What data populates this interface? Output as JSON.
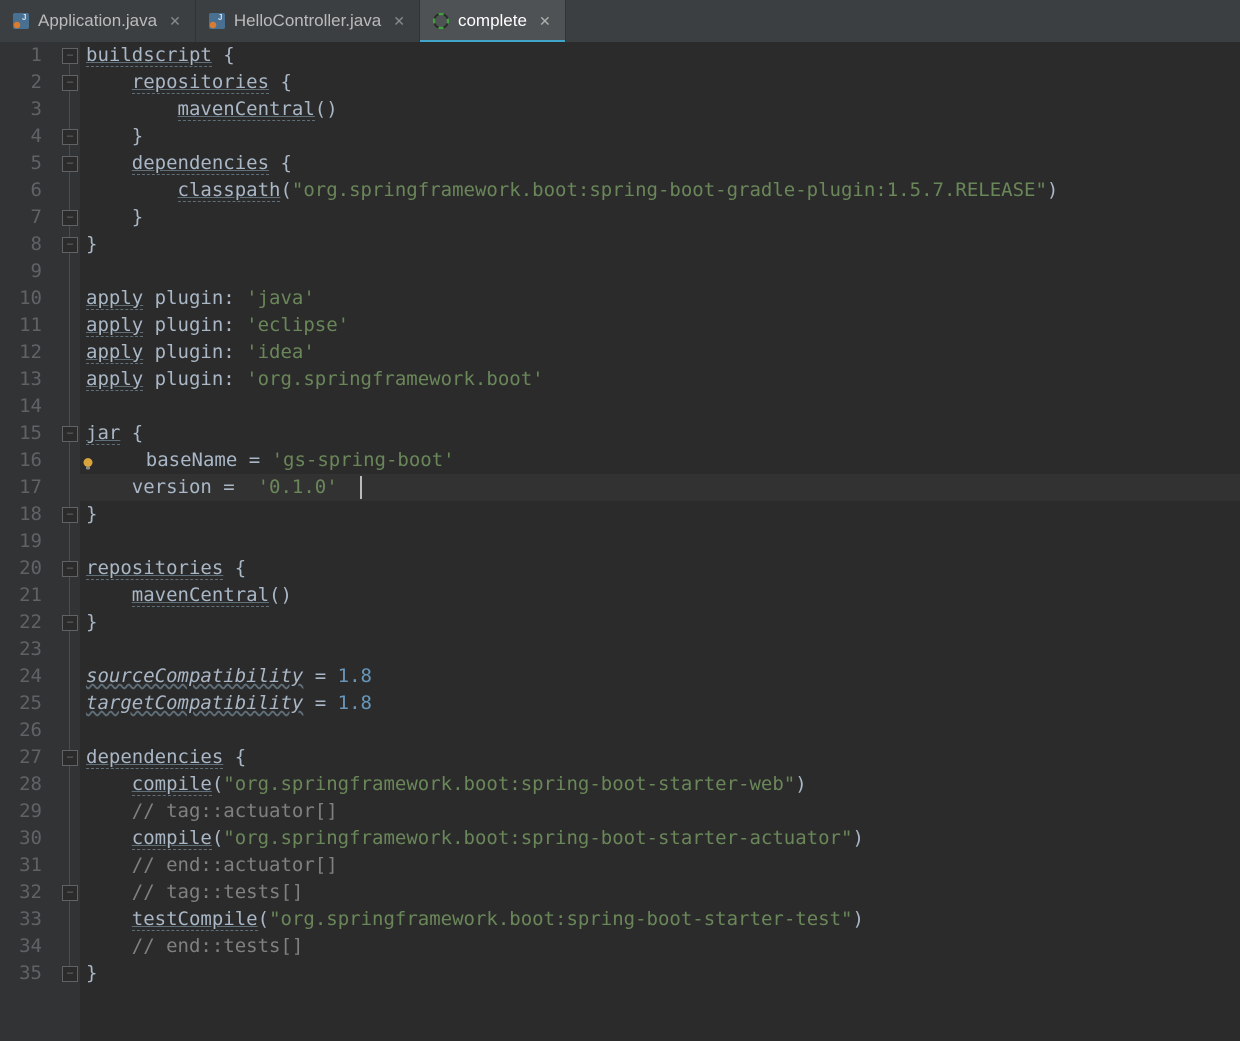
{
  "tabs": [
    {
      "label": "Application.java",
      "icon": "java",
      "active": false
    },
    {
      "label": "HelloController.java",
      "icon": "java",
      "active": false
    },
    {
      "label": "complete",
      "icon": "gradle",
      "active": true
    }
  ],
  "lineCount": 35,
  "highlightLine": 17,
  "caret": {
    "line": 17,
    "colPx": 280
  },
  "bulbLine": 16,
  "foldMarks": [
    {
      "line": 1,
      "kind": "open"
    },
    {
      "line": 2,
      "kind": "open"
    },
    {
      "line": 4,
      "kind": "close"
    },
    {
      "line": 5,
      "kind": "open"
    },
    {
      "line": 7,
      "kind": "close"
    },
    {
      "line": 8,
      "kind": "close"
    },
    {
      "line": 15,
      "kind": "open"
    },
    {
      "line": 18,
      "kind": "close"
    },
    {
      "line": 20,
      "kind": "open"
    },
    {
      "line": 22,
      "kind": "close"
    },
    {
      "line": 27,
      "kind": "open"
    },
    {
      "line": 32,
      "kind": "close"
    },
    {
      "line": 35,
      "kind": "close"
    }
  ],
  "foldLines": [
    {
      "from": 1,
      "to": 35
    }
  ],
  "code": [
    {
      "n": 1,
      "segs": [
        {
          "t": "buildscript",
          "c": "call ul"
        },
        {
          "t": " {",
          "c": "pl"
        }
      ]
    },
    {
      "n": 2,
      "segs": [
        {
          "t": "    "
        },
        {
          "t": "repositories",
          "c": "call ul"
        },
        {
          "t": " {",
          "c": "pl"
        }
      ]
    },
    {
      "n": 3,
      "segs": [
        {
          "t": "        "
        },
        {
          "t": "mavenCentral",
          "c": "call ul"
        },
        {
          "t": "()",
          "c": "pl"
        }
      ]
    },
    {
      "n": 4,
      "segs": [
        {
          "t": "    }",
          "c": "pl"
        }
      ]
    },
    {
      "n": 5,
      "segs": [
        {
          "t": "    "
        },
        {
          "t": "dependencies",
          "c": "call ul"
        },
        {
          "t": " {",
          "c": "pl"
        }
      ]
    },
    {
      "n": 6,
      "segs": [
        {
          "t": "        "
        },
        {
          "t": "classpath",
          "c": "call ul"
        },
        {
          "t": "(",
          "c": "pl"
        },
        {
          "t": "\"org.springframework.boot:spring-boot-gradle-plugin:1.5.7.RELEASE\"",
          "c": "str"
        },
        {
          "t": ")",
          "c": "pl"
        }
      ]
    },
    {
      "n": 7,
      "segs": [
        {
          "t": "    }",
          "c": "pl"
        }
      ]
    },
    {
      "n": 8,
      "segs": [
        {
          "t": "}",
          "c": "pl"
        }
      ]
    },
    {
      "n": 9,
      "segs": [
        {
          "t": ""
        }
      ]
    },
    {
      "n": 10,
      "segs": [
        {
          "t": "apply",
          "c": "call ul"
        },
        {
          "t": " plugin: ",
          "c": "kw"
        },
        {
          "t": "'java'",
          "c": "str"
        }
      ]
    },
    {
      "n": 11,
      "segs": [
        {
          "t": "apply",
          "c": "call ul"
        },
        {
          "t": " plugin: ",
          "c": "kw"
        },
        {
          "t": "'eclipse'",
          "c": "str"
        }
      ]
    },
    {
      "n": 12,
      "segs": [
        {
          "t": "apply",
          "c": "call ul"
        },
        {
          "t": " plugin: ",
          "c": "kw"
        },
        {
          "t": "'idea'",
          "c": "str"
        }
      ]
    },
    {
      "n": 13,
      "segs": [
        {
          "t": "apply",
          "c": "call ul"
        },
        {
          "t": " plugin: ",
          "c": "kw"
        },
        {
          "t": "'org.springframework.boot'",
          "c": "str"
        }
      ]
    },
    {
      "n": 14,
      "segs": [
        {
          "t": ""
        }
      ]
    },
    {
      "n": 15,
      "segs": [
        {
          "t": "jar",
          "c": "call ul"
        },
        {
          "t": " {",
          "c": "pl"
        }
      ]
    },
    {
      "n": 16,
      "segs": [
        {
          "t": "    baseName = ",
          "c": "kw"
        },
        {
          "t": "'gs-spring-boot'",
          "c": "str"
        }
      ]
    },
    {
      "n": 17,
      "segs": [
        {
          "t": "    version =  ",
          "c": "kw"
        },
        {
          "t": "'0.1.0'",
          "c": "str"
        }
      ]
    },
    {
      "n": 18,
      "segs": [
        {
          "t": "}",
          "c": "pl"
        }
      ]
    },
    {
      "n": 19,
      "segs": [
        {
          "t": ""
        }
      ]
    },
    {
      "n": 20,
      "segs": [
        {
          "t": "repositories",
          "c": "call ul"
        },
        {
          "t": " {",
          "c": "pl"
        }
      ]
    },
    {
      "n": 21,
      "segs": [
        {
          "t": "    "
        },
        {
          "t": "mavenCentral",
          "c": "call ul"
        },
        {
          "t": "()",
          "c": "pl"
        }
      ]
    },
    {
      "n": 22,
      "segs": [
        {
          "t": "}",
          "c": "pl"
        }
      ]
    },
    {
      "n": 23,
      "segs": [
        {
          "t": ""
        }
      ]
    },
    {
      "n": 24,
      "segs": [
        {
          "t": "sourceCompatibility",
          "c": "kw wavy ital"
        },
        {
          "t": " = ",
          "c": "kw"
        },
        {
          "t": "1.8",
          "c": "num"
        }
      ]
    },
    {
      "n": 25,
      "segs": [
        {
          "t": "targetCompatibility",
          "c": "kw wavy ital"
        },
        {
          "t": " = ",
          "c": "kw"
        },
        {
          "t": "1.8",
          "c": "num"
        }
      ]
    },
    {
      "n": 26,
      "segs": [
        {
          "t": ""
        }
      ]
    },
    {
      "n": 27,
      "segs": [
        {
          "t": "dependencies",
          "c": "call ul"
        },
        {
          "t": " {",
          "c": "pl"
        }
      ]
    },
    {
      "n": 28,
      "segs": [
        {
          "t": "    "
        },
        {
          "t": "compile",
          "c": "call ul"
        },
        {
          "t": "(",
          "c": "pl"
        },
        {
          "t": "\"org.springframework.boot:spring-boot-starter-web\"",
          "c": "str"
        },
        {
          "t": ")",
          "c": "pl"
        }
      ]
    },
    {
      "n": 29,
      "segs": [
        {
          "t": "    "
        },
        {
          "t": "// tag::actuator[]",
          "c": "cm"
        }
      ]
    },
    {
      "n": 30,
      "segs": [
        {
          "t": "    "
        },
        {
          "t": "compile",
          "c": "call ul"
        },
        {
          "t": "(",
          "c": "pl"
        },
        {
          "t": "\"org.springframework.boot:spring-boot-starter-actuator\"",
          "c": "str"
        },
        {
          "t": ")",
          "c": "pl"
        }
      ]
    },
    {
      "n": 31,
      "segs": [
        {
          "t": "    "
        },
        {
          "t": "// end::actuator[]",
          "c": "cm"
        }
      ]
    },
    {
      "n": 32,
      "segs": [
        {
          "t": "    "
        },
        {
          "t": "// tag::tests[]",
          "c": "cm"
        }
      ]
    },
    {
      "n": 33,
      "segs": [
        {
          "t": "    "
        },
        {
          "t": "testCompile",
          "c": "call ul"
        },
        {
          "t": "(",
          "c": "pl"
        },
        {
          "t": "\"org.springframework.boot:spring-boot-starter-test\"",
          "c": "str"
        },
        {
          "t": ")",
          "c": "pl"
        }
      ]
    },
    {
      "n": 34,
      "segs": [
        {
          "t": "    "
        },
        {
          "t": "// end::tests[]",
          "c": "cm"
        }
      ]
    },
    {
      "n": 35,
      "segs": [
        {
          "t": "}",
          "c": "pl"
        }
      ]
    }
  ]
}
